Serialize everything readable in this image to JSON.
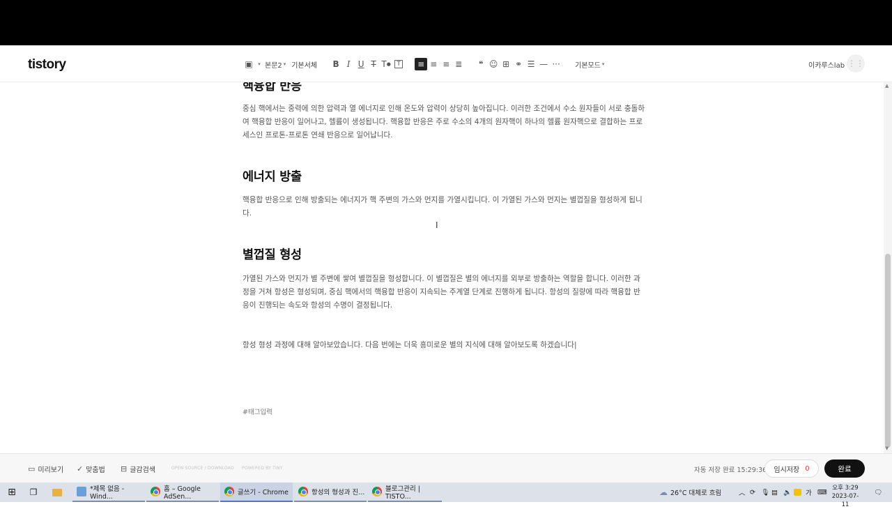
{
  "header": {
    "logo": "tistory",
    "toolbar": {
      "paragraph_style": "본문2",
      "font": "기본서체",
      "mode": "기본모드"
    },
    "user_name": "이카루스lab"
  },
  "article": {
    "partial_heading": "핵융합 반응",
    "para1": "중심 핵에서는 중력에 의한 압력과 열 에너지로 인해 온도와 압력이 상당히 높아집니다. 이러한 조건에서 수소 원자들이 서로 충돌하여 핵융합 반응이 일어나고, 헬륨이 생성됩니다. 핵융합 반응은 주로 수소의 4개의 원자핵이 하나의 헬륨 원자핵으로 결합하는 프로세스인 프로톤-프로톤 연쇄 반응으로 일어납니다.",
    "heading2": "에너지 방출",
    "para2": "핵융합 반응으로 인해 방출되는 에너지가 핵 주변의 가스와 먼지를 가열시킵니다. 이 가열된 가스와 먼지는 별껍질을 형성하게 됩니다.",
    "heading3": "별껍질 형성",
    "para3": "가열된 가스와 먼지가 별 주변에 쌓여 별껍질을 형성합니다. 이 별껍질은 별의 에너지를 외부로 방출하는 역할을 합니다. 이러한 과정을 거쳐 항성은 형성되며, 중심 핵에서의 핵융합 반응이 지속되는 주계열 단계로 진행하게 됩니다. 항성의 질량에 따라 핵융합 반응이 진행되는 속도와 항성의 수명이 결정됩니다.",
    "closing": "항성 형성 과정에 대해 알아보았습니다. 다음 번에는 더욱 흥미로운 별의 지식에 대해 알아보도록 하겠습니다|",
    "tag_placeholder": "#태그입력"
  },
  "footer": {
    "preview": "미리보기",
    "spellcheck": "맞춤법",
    "text_search": "글감검색",
    "credit1": "OPEN SOURCE / DOWNLOAD",
    "credit2": "POWERED BY TINY",
    "autosave": "자동 저장 완료 15:29:36",
    "draft_label": "임시저장",
    "draft_count": "0",
    "publish": "완료"
  },
  "taskbar": {
    "apps": [
      "*제목 없음 - Wind...",
      "홈 – Google AdSen...",
      "글쓰기 - Chrome",
      "항성의 형성과 진...",
      "블로그관리 | TISTO..."
    ],
    "weather": "26°C  대체로 흐림",
    "ime": "가",
    "time": "오후 3:29",
    "date": "2023-07-11"
  }
}
